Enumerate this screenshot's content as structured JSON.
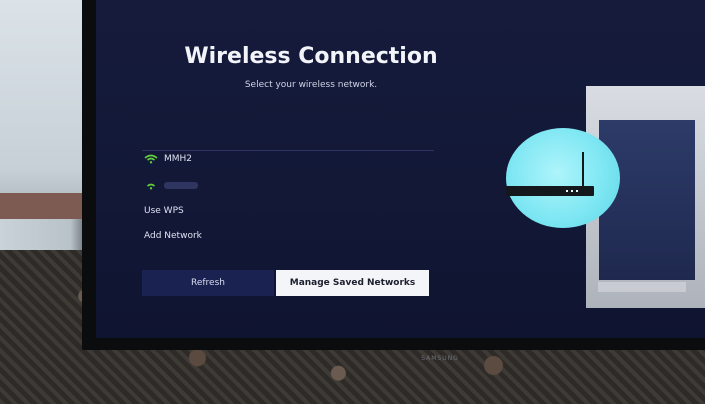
{
  "screen": {
    "title": "Wireless Connection",
    "subtitle": "Select your wireless network."
  },
  "networks": [
    {
      "ssid": "MMH2",
      "icon": "wifi-signal-icon"
    },
    {
      "ssid": "",
      "icon": "wifi-signal-icon"
    }
  ],
  "menu": {
    "use_wps": "Use WPS",
    "add_network": "Add Network"
  },
  "buttons": {
    "refresh": "Refresh",
    "manage_saved": "Manage Saved Networks"
  },
  "tv": {
    "brand": "SAMSUNG"
  },
  "colors": {
    "screen_bg": "#141a3a",
    "wifi_green": "#5fcf3c",
    "selected_button": "#f4f5f8",
    "illustration_accent": "#7fe7f3"
  }
}
